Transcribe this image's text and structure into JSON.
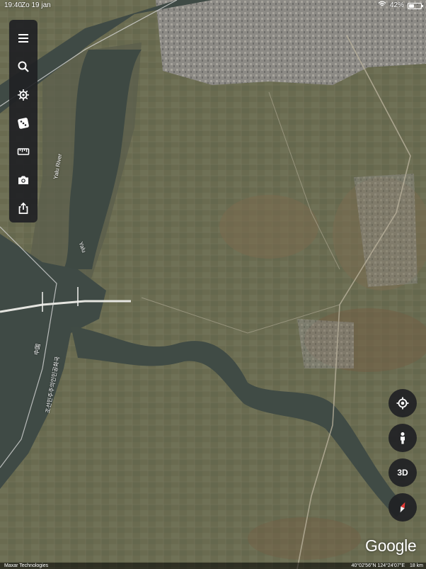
{
  "status_bar": {
    "time": "19:40",
    "date": "Zo 19 jan",
    "battery": "42%",
    "battery_level": 0.42
  },
  "map": {
    "labels": {
      "river_1": "Yalu River",
      "river_2": "Yalu",
      "border_cn": "中国",
      "border_kr": "조선민주주의인민공화국"
    }
  },
  "toolbar": {
    "items": [
      "menu-icon",
      "search-icon",
      "voyager-icon",
      "dice-icon",
      "ruler-icon",
      "camera-icon",
      "share-icon"
    ]
  },
  "controls": {
    "view_3d": "3D"
  },
  "branding": {
    "logo": "Google"
  },
  "footer": {
    "attribution": "Maxar Technologies",
    "coordinates": "40°02'56\"N 124°24'07\"E",
    "scale": "18 km"
  }
}
